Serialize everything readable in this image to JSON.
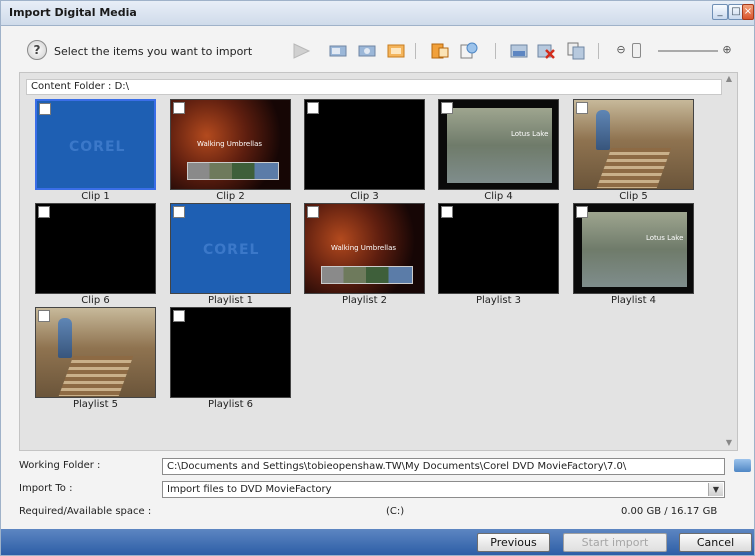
{
  "window": {
    "title": "Import Digital Media",
    "controls": [
      "minimize",
      "maximize",
      "close"
    ]
  },
  "toolbar": {
    "prompt": "Select the items you want to import",
    "icons": [
      "help-icon",
      "play-icon",
      "video-properties-icon",
      "audio-properties-icon",
      "edit-icon",
      "export-icon",
      "recent-icon",
      "select-all-icon",
      "delete-icon",
      "merge-icon",
      "zoom-out-icon",
      "zoom-in-icon"
    ]
  },
  "content_folder": {
    "label": "Content Folder : D:\\"
  },
  "tiles": [
    {
      "label": "Clip 1",
      "style": "blue",
      "selected": true
    },
    {
      "label": "Clip 2",
      "style": "dark-red"
    },
    {
      "label": "Clip 3",
      "style": "black"
    },
    {
      "label": "Clip 4",
      "style": "lake"
    },
    {
      "label": "Clip 5",
      "style": "forest"
    },
    {
      "label": "Clip 6",
      "style": "black"
    },
    {
      "label": "Playlist 1",
      "style": "blue"
    },
    {
      "label": "Playlist 2",
      "style": "dark-red"
    },
    {
      "label": "Playlist 3",
      "style": "black"
    },
    {
      "label": "Playlist 4",
      "style": "lake"
    },
    {
      "label": "Playlist 5",
      "style": "forest"
    },
    {
      "label": "Playlist 6",
      "style": "black"
    }
  ],
  "thumb_text": {
    "walking": "Walking Umbrellas",
    "lotus": "Lotus Lake",
    "corel": "COREL"
  },
  "form": {
    "working_folder_label": "Working Folder :",
    "working_folder_value": "C:\\Documents and Settings\\tobieopenshaw.TW\\My Documents\\Corel DVD MovieFactory\\7.0\\",
    "import_to_label": "Import To :",
    "import_to_value": "Import files to DVD MovieFactory",
    "space_label": "Required/Available space :",
    "space_drive": "(C:)",
    "space_value": "0.00 GB / 16.17 GB"
  },
  "buttons": {
    "previous": "Previous",
    "start_import": "Start import",
    "cancel": "Cancel"
  },
  "colors": {
    "selection": "#3a6ee8",
    "bottom_bar": "#2d5ea6",
    "blue_thumb": "#1e5fb3"
  }
}
